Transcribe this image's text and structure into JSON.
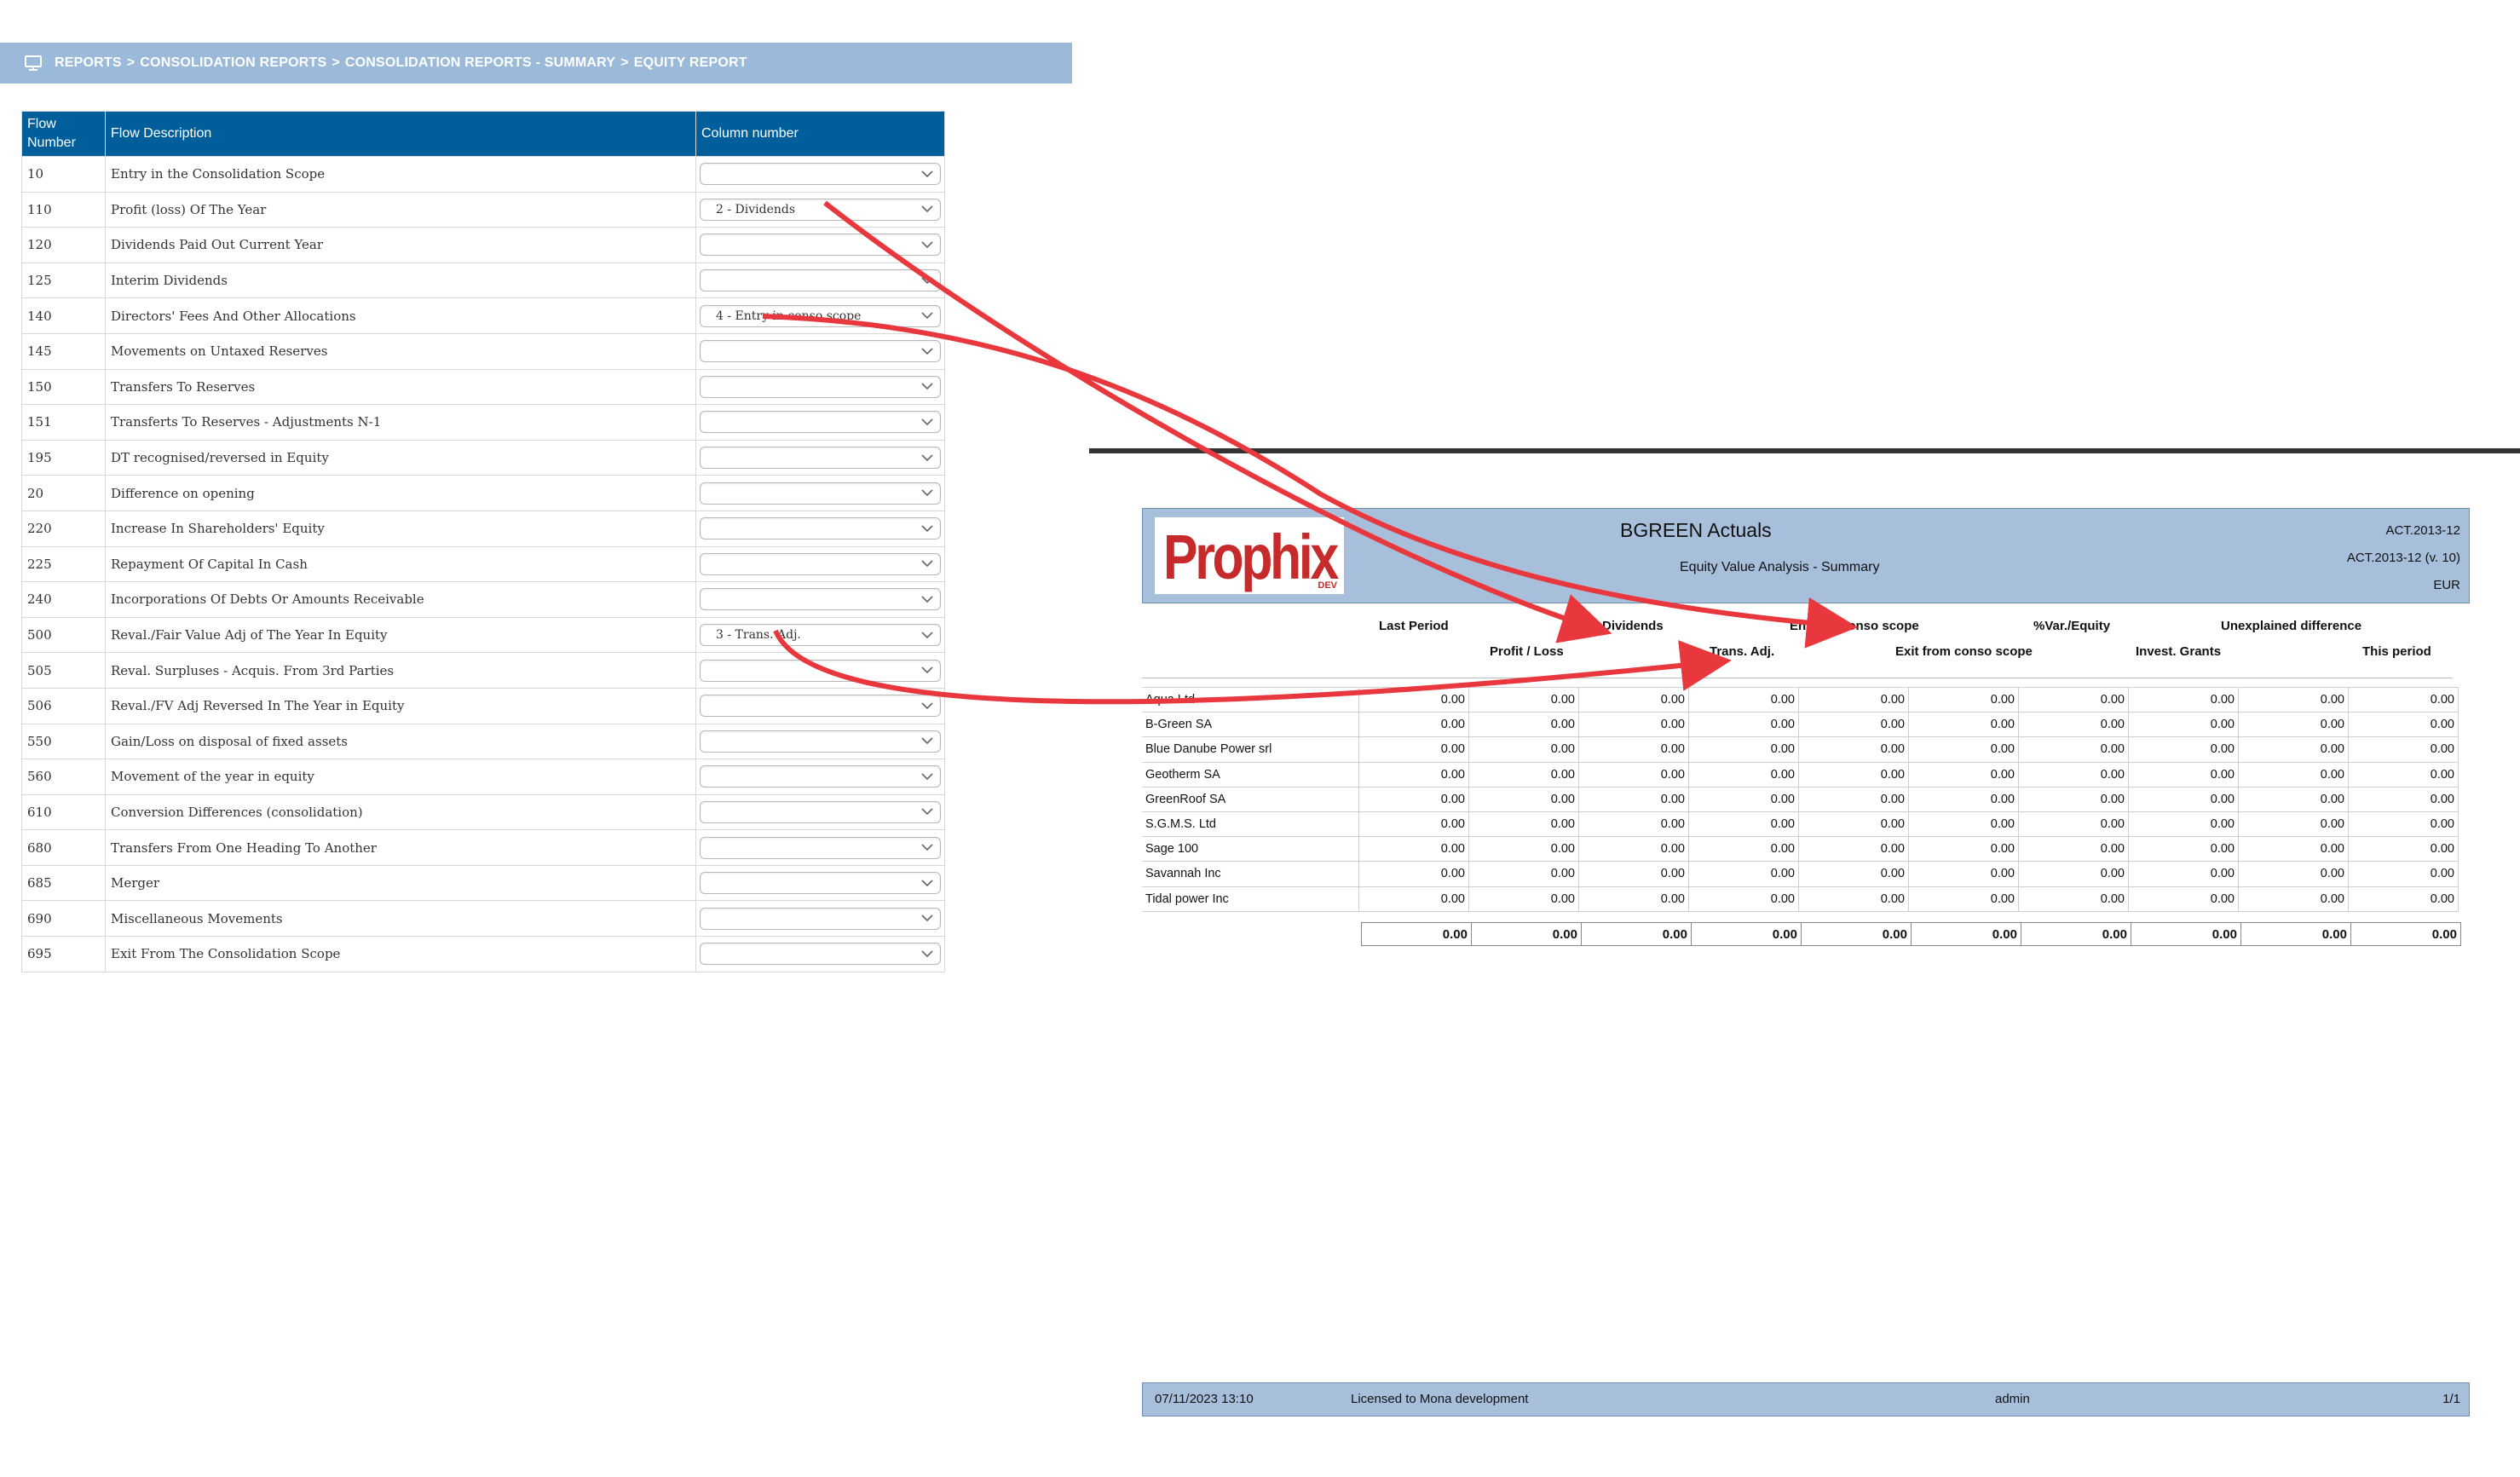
{
  "breadcrumb": {
    "items": [
      "REPORTS",
      "CONSOLIDATION REPORTS",
      "CONSOLIDATION REPORTS - SUMMARY",
      "EQUITY REPORT"
    ],
    "separator": ">",
    "icon": "monitor-icon"
  },
  "flow_table": {
    "headers": {
      "flow_number": "Flow Number",
      "flow_description": "Flow Description",
      "column_number": "Column number"
    },
    "rows": [
      {
        "number": "10",
        "description": "Entry in the Consolidation Scope",
        "column": ""
      },
      {
        "number": "110",
        "description": "Profit (loss) Of The Year",
        "column": "2 - Dividends"
      },
      {
        "number": "120",
        "description": "Dividends Paid Out Current Year",
        "column": ""
      },
      {
        "number": "125",
        "description": "Interim Dividends",
        "column": ""
      },
      {
        "number": "140",
        "description": "Directors' Fees And Other Allocations",
        "column": "4 - Entry in conso scope"
      },
      {
        "number": "145",
        "description": "Movements on Untaxed Reserves",
        "column": ""
      },
      {
        "number": "150",
        "description": "Transfers To Reserves",
        "column": ""
      },
      {
        "number": "151",
        "description": "Transferts To Reserves - Adjustments N-1",
        "column": ""
      },
      {
        "number": "195",
        "description": "DT recognised/reversed in Equity",
        "column": ""
      },
      {
        "number": "20",
        "description": "Difference on opening",
        "column": ""
      },
      {
        "number": "220",
        "description": "Increase In Shareholders' Equity",
        "column": ""
      },
      {
        "number": "225",
        "description": "Repayment Of Capital In Cash",
        "column": ""
      },
      {
        "number": "240",
        "description": "Incorporations Of Debts Or Amounts Receivable",
        "column": ""
      },
      {
        "number": "500",
        "description": "Reval./Fair Value Adj of The Year In Equity",
        "column": "3 - Trans. Adj."
      },
      {
        "number": "505",
        "description": "Reval. Surpluses - Acquis. From 3rd Parties",
        "column": ""
      },
      {
        "number": "506",
        "description": "Reval./FV Adj Reversed In The Year in Equity",
        "column": ""
      },
      {
        "number": "550",
        "description": "Gain/Loss on disposal of fixed assets",
        "column": ""
      },
      {
        "number": "560",
        "description": "Movement of the year in equity",
        "column": ""
      },
      {
        "number": "610",
        "description": "Conversion Differences (consolidation)",
        "column": ""
      },
      {
        "number": "680",
        "description": "Transfers From One Heading To Another",
        "column": ""
      },
      {
        "number": "685",
        "description": "Merger",
        "column": ""
      },
      {
        "number": "690",
        "description": "Miscellaneous Movements",
        "column": ""
      },
      {
        "number": "695",
        "description": "Exit From The Consolidation Scope",
        "column": ""
      }
    ]
  },
  "report": {
    "logo_text": "Prophix",
    "logo_sub": "DEV",
    "title": "BGREEN Actuals",
    "subtitle": "Equity Value Analysis - Summary",
    "right_lines": [
      "ACT.2013-12",
      "ACT.2013-12 (v. 10)",
      "EUR"
    ],
    "column_headers_top": [
      "Last Period",
      "Dividends",
      "Entry in conso scope",
      "%Var./Equity",
      "Unexplained difference"
    ],
    "column_headers_bottom": [
      "Profit / Loss",
      "Trans. Adj.",
      "Exit from conso scope",
      "Invest. Grants",
      "This period"
    ],
    "rows": [
      {
        "entity": "Aqua Ltd",
        "values": [
          "0.00",
          "0.00",
          "0.00",
          "0.00",
          "0.00",
          "0.00",
          "0.00",
          "0.00",
          "0.00",
          "0.00"
        ]
      },
      {
        "entity": "B-Green SA",
        "values": [
          "0.00",
          "0.00",
          "0.00",
          "0.00",
          "0.00",
          "0.00",
          "0.00",
          "0.00",
          "0.00",
          "0.00"
        ]
      },
      {
        "entity": "Blue Danube Power srl",
        "values": [
          "0.00",
          "0.00",
          "0.00",
          "0.00",
          "0.00",
          "0.00",
          "0.00",
          "0.00",
          "0.00",
          "0.00"
        ]
      },
      {
        "entity": "Geotherm SA",
        "values": [
          "0.00",
          "0.00",
          "0.00",
          "0.00",
          "0.00",
          "0.00",
          "0.00",
          "0.00",
          "0.00",
          "0.00"
        ]
      },
      {
        "entity": "GreenRoof SA",
        "values": [
          "0.00",
          "0.00",
          "0.00",
          "0.00",
          "0.00",
          "0.00",
          "0.00",
          "0.00",
          "0.00",
          "0.00"
        ]
      },
      {
        "entity": "S.G.M.S. Ltd",
        "values": [
          "0.00",
          "0.00",
          "0.00",
          "0.00",
          "0.00",
          "0.00",
          "0.00",
          "0.00",
          "0.00",
          "0.00"
        ]
      },
      {
        "entity": "Sage 100",
        "values": [
          "0.00",
          "0.00",
          "0.00",
          "0.00",
          "0.00",
          "0.00",
          "0.00",
          "0.00",
          "0.00",
          "0.00"
        ]
      },
      {
        "entity": "Savannah Inc",
        "values": [
          "0.00",
          "0.00",
          "0.00",
          "0.00",
          "0.00",
          "0.00",
          "0.00",
          "0.00",
          "0.00",
          "0.00"
        ]
      },
      {
        "entity": "Tidal power Inc",
        "values": [
          "0.00",
          "0.00",
          "0.00",
          "0.00",
          "0.00",
          "0.00",
          "0.00",
          "0.00",
          "0.00",
          "0.00"
        ]
      }
    ],
    "totals": [
      "0.00",
      "0.00",
      "0.00",
      "0.00",
      "0.00",
      "0.00",
      "0.00",
      "0.00",
      "0.00",
      "0.00"
    ]
  },
  "footer": {
    "datetime": "07/11/2023 13:10",
    "license": "Licensed to Mona development",
    "user": "admin",
    "page": "1/1"
  },
  "colors": {
    "breadcrumb_bg": "#9bbad9",
    "table_header_bg": "#005e9a",
    "report_band_bg": "#a8bfdc",
    "logo_red": "#c62a2a",
    "arrow_red": "#e8383d"
  }
}
